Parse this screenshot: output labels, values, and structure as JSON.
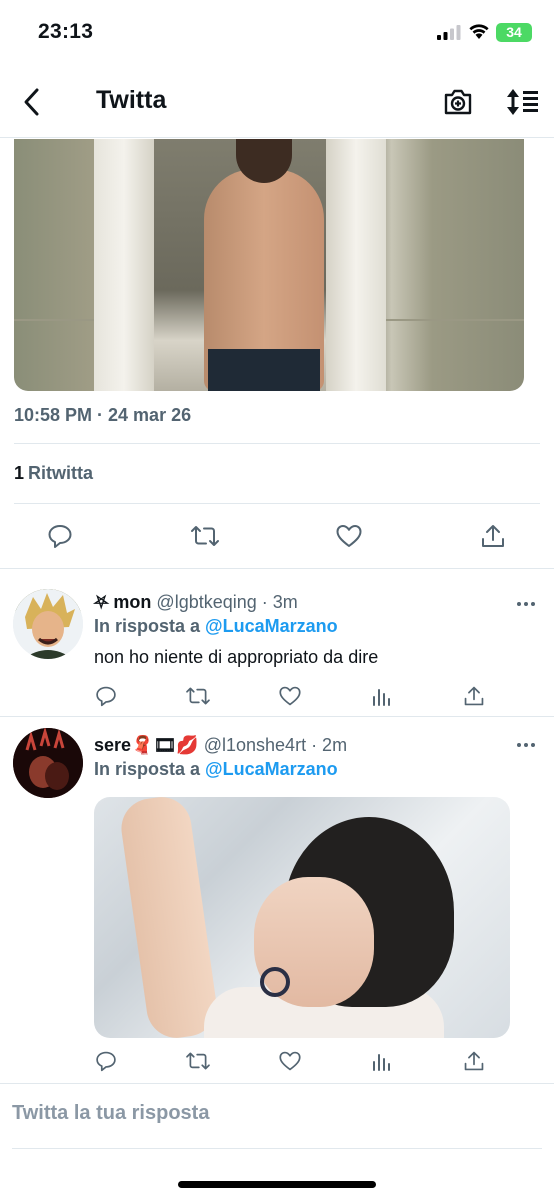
{
  "status_bar": {
    "time": "23:13",
    "battery": "34"
  },
  "header": {
    "title": "Twitta"
  },
  "tweet": {
    "timestamp": "10:58 PM · 24 mar 26",
    "retweet_count": "1",
    "retweet_label": "Ritwitta"
  },
  "replies": [
    {
      "name": "⛧ mon",
      "handle": "@lgbtkeqing · 3m",
      "in_reply_prefix": "In risposta a",
      "mention": "@LucaMarzano",
      "text": "non ho niente di appropriato da dire"
    },
    {
      "name": "sere🧣🎞💋",
      "handle": "@l1onshe4rt · 2m",
      "in_reply_prefix": "In risposta a",
      "mention": "@LucaMarzano"
    }
  ],
  "compose": {
    "placeholder": "Twitta la tua risposta"
  },
  "colors": {
    "accent": "#1d9bf0",
    "muted": "#536471",
    "battery": "#4cd964"
  }
}
